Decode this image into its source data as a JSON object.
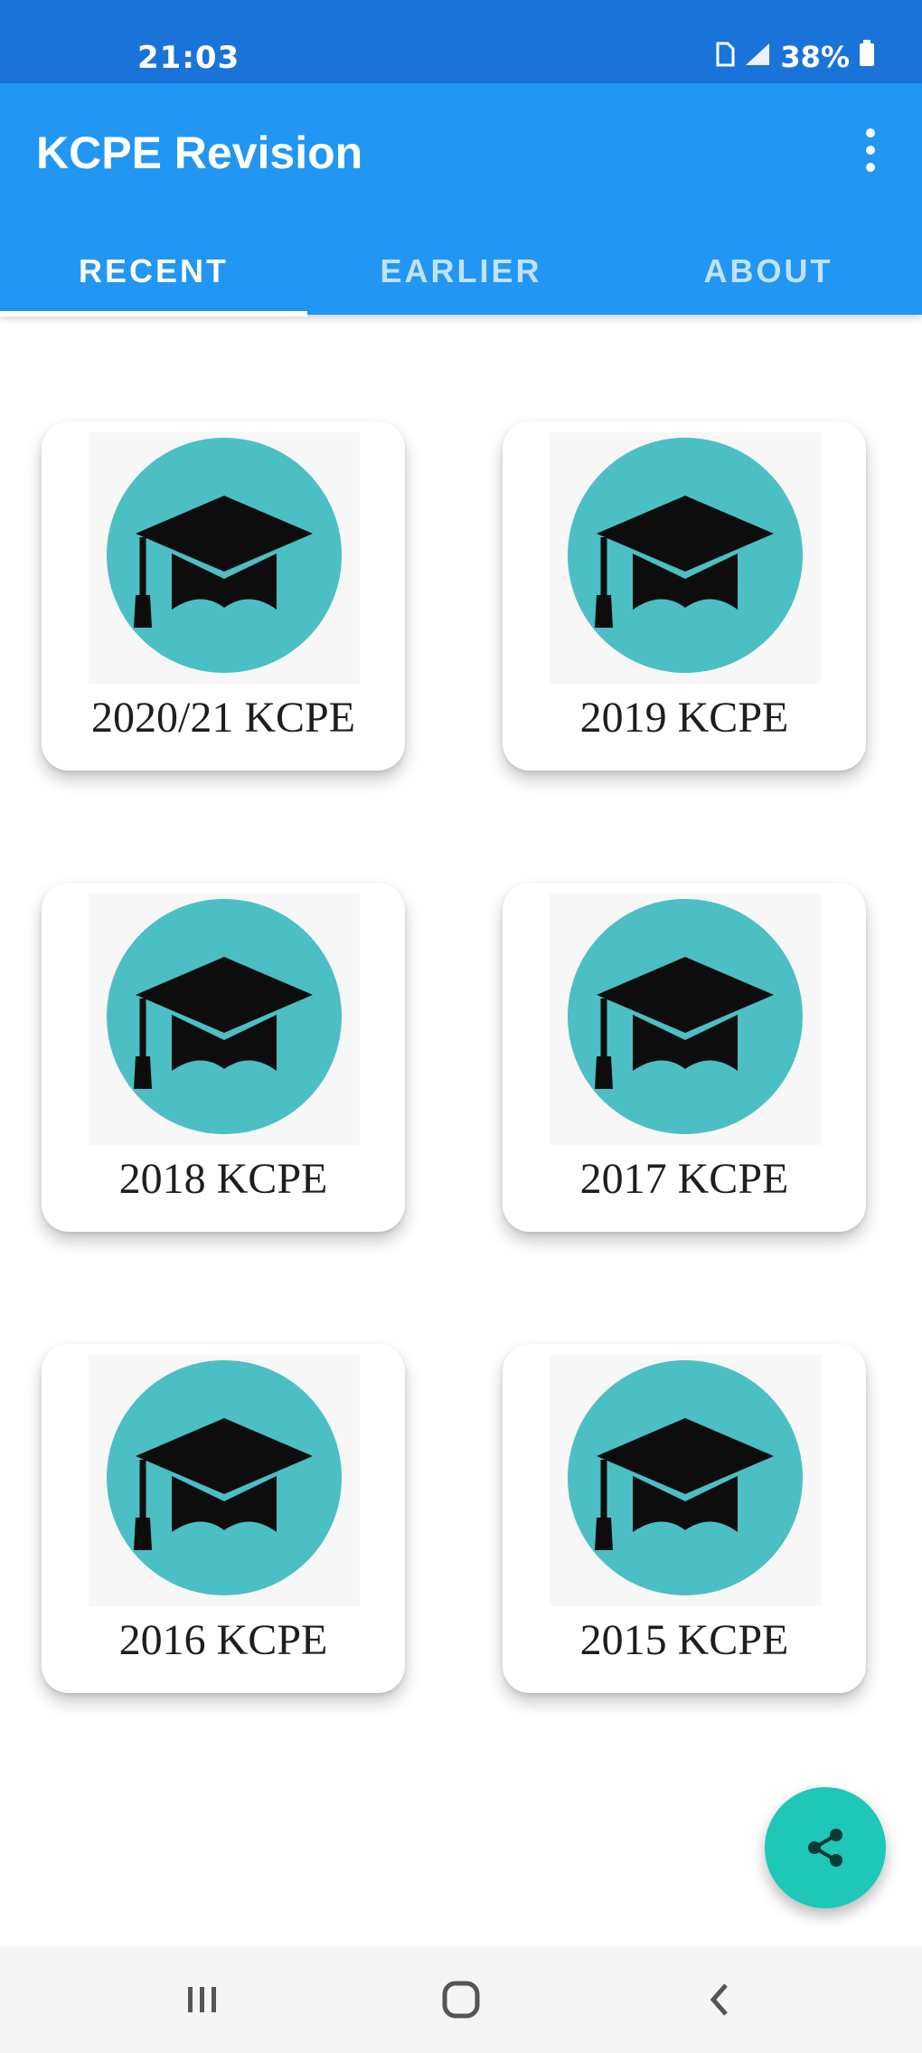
{
  "status_bar": {
    "time": "21:03",
    "battery": "38%",
    "icons": [
      "sim-icon",
      "signal-icon",
      "battery-icon"
    ]
  },
  "app_bar": {
    "title": "KCPE Revision",
    "menu_icon": "more-vert-icon",
    "tabs": [
      {
        "label": "RECENT",
        "selected": true
      },
      {
        "label": "EARLIER",
        "selected": false
      },
      {
        "label": "ABOUT",
        "selected": false
      }
    ]
  },
  "papers": [
    {
      "label": "2020/21 KCPE",
      "icon": "graduation-cap-icon"
    },
    {
      "label": "2019 KCPE",
      "icon": "graduation-cap-icon"
    },
    {
      "label": "2018 KCPE",
      "icon": "graduation-cap-icon"
    },
    {
      "label": "2017 KCPE",
      "icon": "graduation-cap-icon"
    },
    {
      "label": "2016 KCPE",
      "icon": "graduation-cap-icon"
    },
    {
      "label": "2015 KCPE",
      "icon": "graduation-cap-icon"
    }
  ],
  "fab": {
    "icon": "share-icon"
  },
  "nav_bar": {
    "icons": [
      "recent-apps-icon",
      "home-icon",
      "back-icon"
    ]
  },
  "colors": {
    "status_bar": "#1a73d9",
    "app_bar": "#2196f3",
    "cap_circle": "#4bbfc4",
    "fab": "#1ec7b8"
  }
}
